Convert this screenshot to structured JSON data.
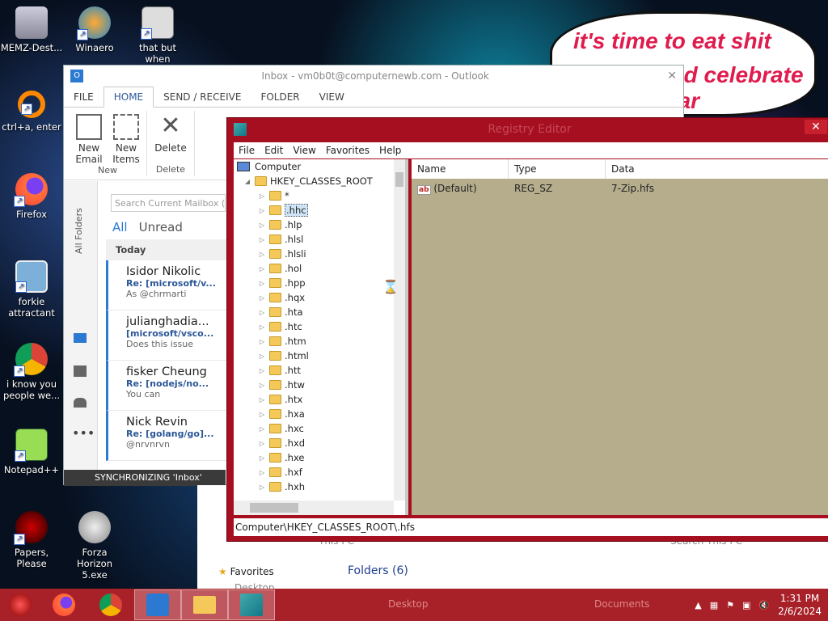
{
  "desktop": {
    "icons": [
      {
        "label": "MEMZ-Dest..."
      },
      {
        "label": "Winaero"
      },
      {
        "label": "that but when"
      },
      {
        "label": "ctrl+a, enter"
      },
      {
        "label": "Firefox"
      },
      {
        "label": "forkie attractant"
      },
      {
        "label": "i know you people we..."
      },
      {
        "label": "Notepad++"
      },
      {
        "label": "Papers, Please"
      },
      {
        "label": "Forza Horizon 5.exe"
      }
    ],
    "bubble_lines": [
      "it's time to eat shit",
      "and celebrate",
      "ear"
    ]
  },
  "outlook": {
    "title": "Inbox - vm0b0t@computernewb.com - Outlook",
    "tabs": [
      "FILE",
      "HOME",
      "SEND / RECEIVE",
      "FOLDER",
      "VIEW"
    ],
    "ribbon": {
      "new_email": "New Email",
      "new_items": "New Items",
      "group_new": "New",
      "delete": "Delete",
      "group_delete": "Delete"
    },
    "all_folders": "All Folders",
    "search_placeholder": "Search Current Mailbox (Ct",
    "filter_all": "All",
    "filter_unread": "Unread",
    "today": "Today",
    "mails": [
      {
        "from": "Isidor Nikolic",
        "subject": "Re: [microsoft/v...",
        "preview": "As @chrmarti"
      },
      {
        "from": "julianghadia...",
        "subject": "[microsoft/vsco...",
        "preview": "Does this issue"
      },
      {
        "from": "fisker Cheung",
        "subject": "Re: [nodejs/no...",
        "preview": "You can"
      },
      {
        "from": "Nick Revin",
        "subject": "Re: [golang/go]...",
        "preview": "@nrvnrvn"
      }
    ],
    "sync_status": "SYNCHRONIZING 'Inbox'"
  },
  "regedit": {
    "title": "Registry Editor",
    "menu": [
      "File",
      "Edit",
      "View",
      "Favorites",
      "Help"
    ],
    "tree_root": "Computer",
    "tree_hive": "HKEY_CLASSES_ROOT",
    "tree_keys": [
      "*",
      ".hhc",
      ".hlp",
      ".hlsl",
      ".hlsli",
      ".hol",
      ".hpp",
      ".hqx",
      ".hta",
      ".htc",
      ".htm",
      ".html",
      ".htt",
      ".htw",
      ".htx",
      ".hxa",
      ".hxc",
      ".hxd",
      ".hxe",
      ".hxf",
      ".hxh"
    ],
    "columns": [
      "Name",
      "Type",
      "Data"
    ],
    "values": [
      {
        "name": "(Default)",
        "type": "REG_SZ",
        "data": "7-Zip.hfs"
      }
    ],
    "status_path": "Computer\\HKEY_CLASSES_ROOT\\.hfs"
  },
  "explorer": {
    "this_pc": "This PC",
    "search": "Search This PC",
    "favorites": "Favorites",
    "desktop": "Desktop",
    "folders": "Folders (6)",
    "taskbar_desktop": "Desktop",
    "taskbar_documents": "Documents"
  },
  "taskbar": {
    "time": "1:31 PM",
    "date": "2/6/2024"
  }
}
